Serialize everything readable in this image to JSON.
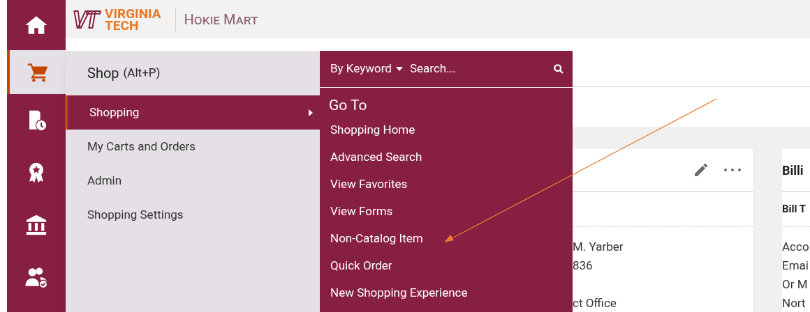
{
  "sidebar": {
    "items": [
      {
        "kind": "home",
        "selected": false
      },
      {
        "kind": "cart",
        "selected": true
      },
      {
        "kind": "orders",
        "selected": false
      },
      {
        "kind": "award",
        "selected": false
      },
      {
        "kind": "bank",
        "selected": false
      },
      {
        "kind": "people",
        "selected": false
      }
    ]
  },
  "header": {
    "logo": {
      "mark": "VT",
      "line1": "VIRGINIA",
      "line2": "TECH"
    },
    "app_name": "Hokie Mart"
  },
  "flyout": {
    "title": "Shop",
    "shortcut": "(Alt+P)",
    "items": [
      {
        "label": "Shopping",
        "selected": true,
        "has_submenu": true
      },
      {
        "label": "My Carts and Orders",
        "selected": false,
        "has_submenu": false
      },
      {
        "label": "Admin",
        "selected": false,
        "has_submenu": false
      },
      {
        "label": "Shopping Settings",
        "selected": false,
        "has_submenu": false
      }
    ]
  },
  "submenu": {
    "search": {
      "scope": "By Keyword",
      "placeholder": "Search..."
    },
    "heading": "Go To",
    "links": [
      "Shopping Home",
      "Advanced Search",
      "View Favorites",
      "View Forms",
      "Non-Catalog Item",
      "Quick Order",
      "New Shopping Experience"
    ]
  },
  "card": {
    "lines": [
      "M. Yarber",
      "836",
      "ct Office"
    ]
  },
  "billing": {
    "title": "Billi",
    "subtitle": "Bill T",
    "lines": [
      "Acco",
      "Emai",
      "Or M",
      "Nort"
    ]
  }
}
